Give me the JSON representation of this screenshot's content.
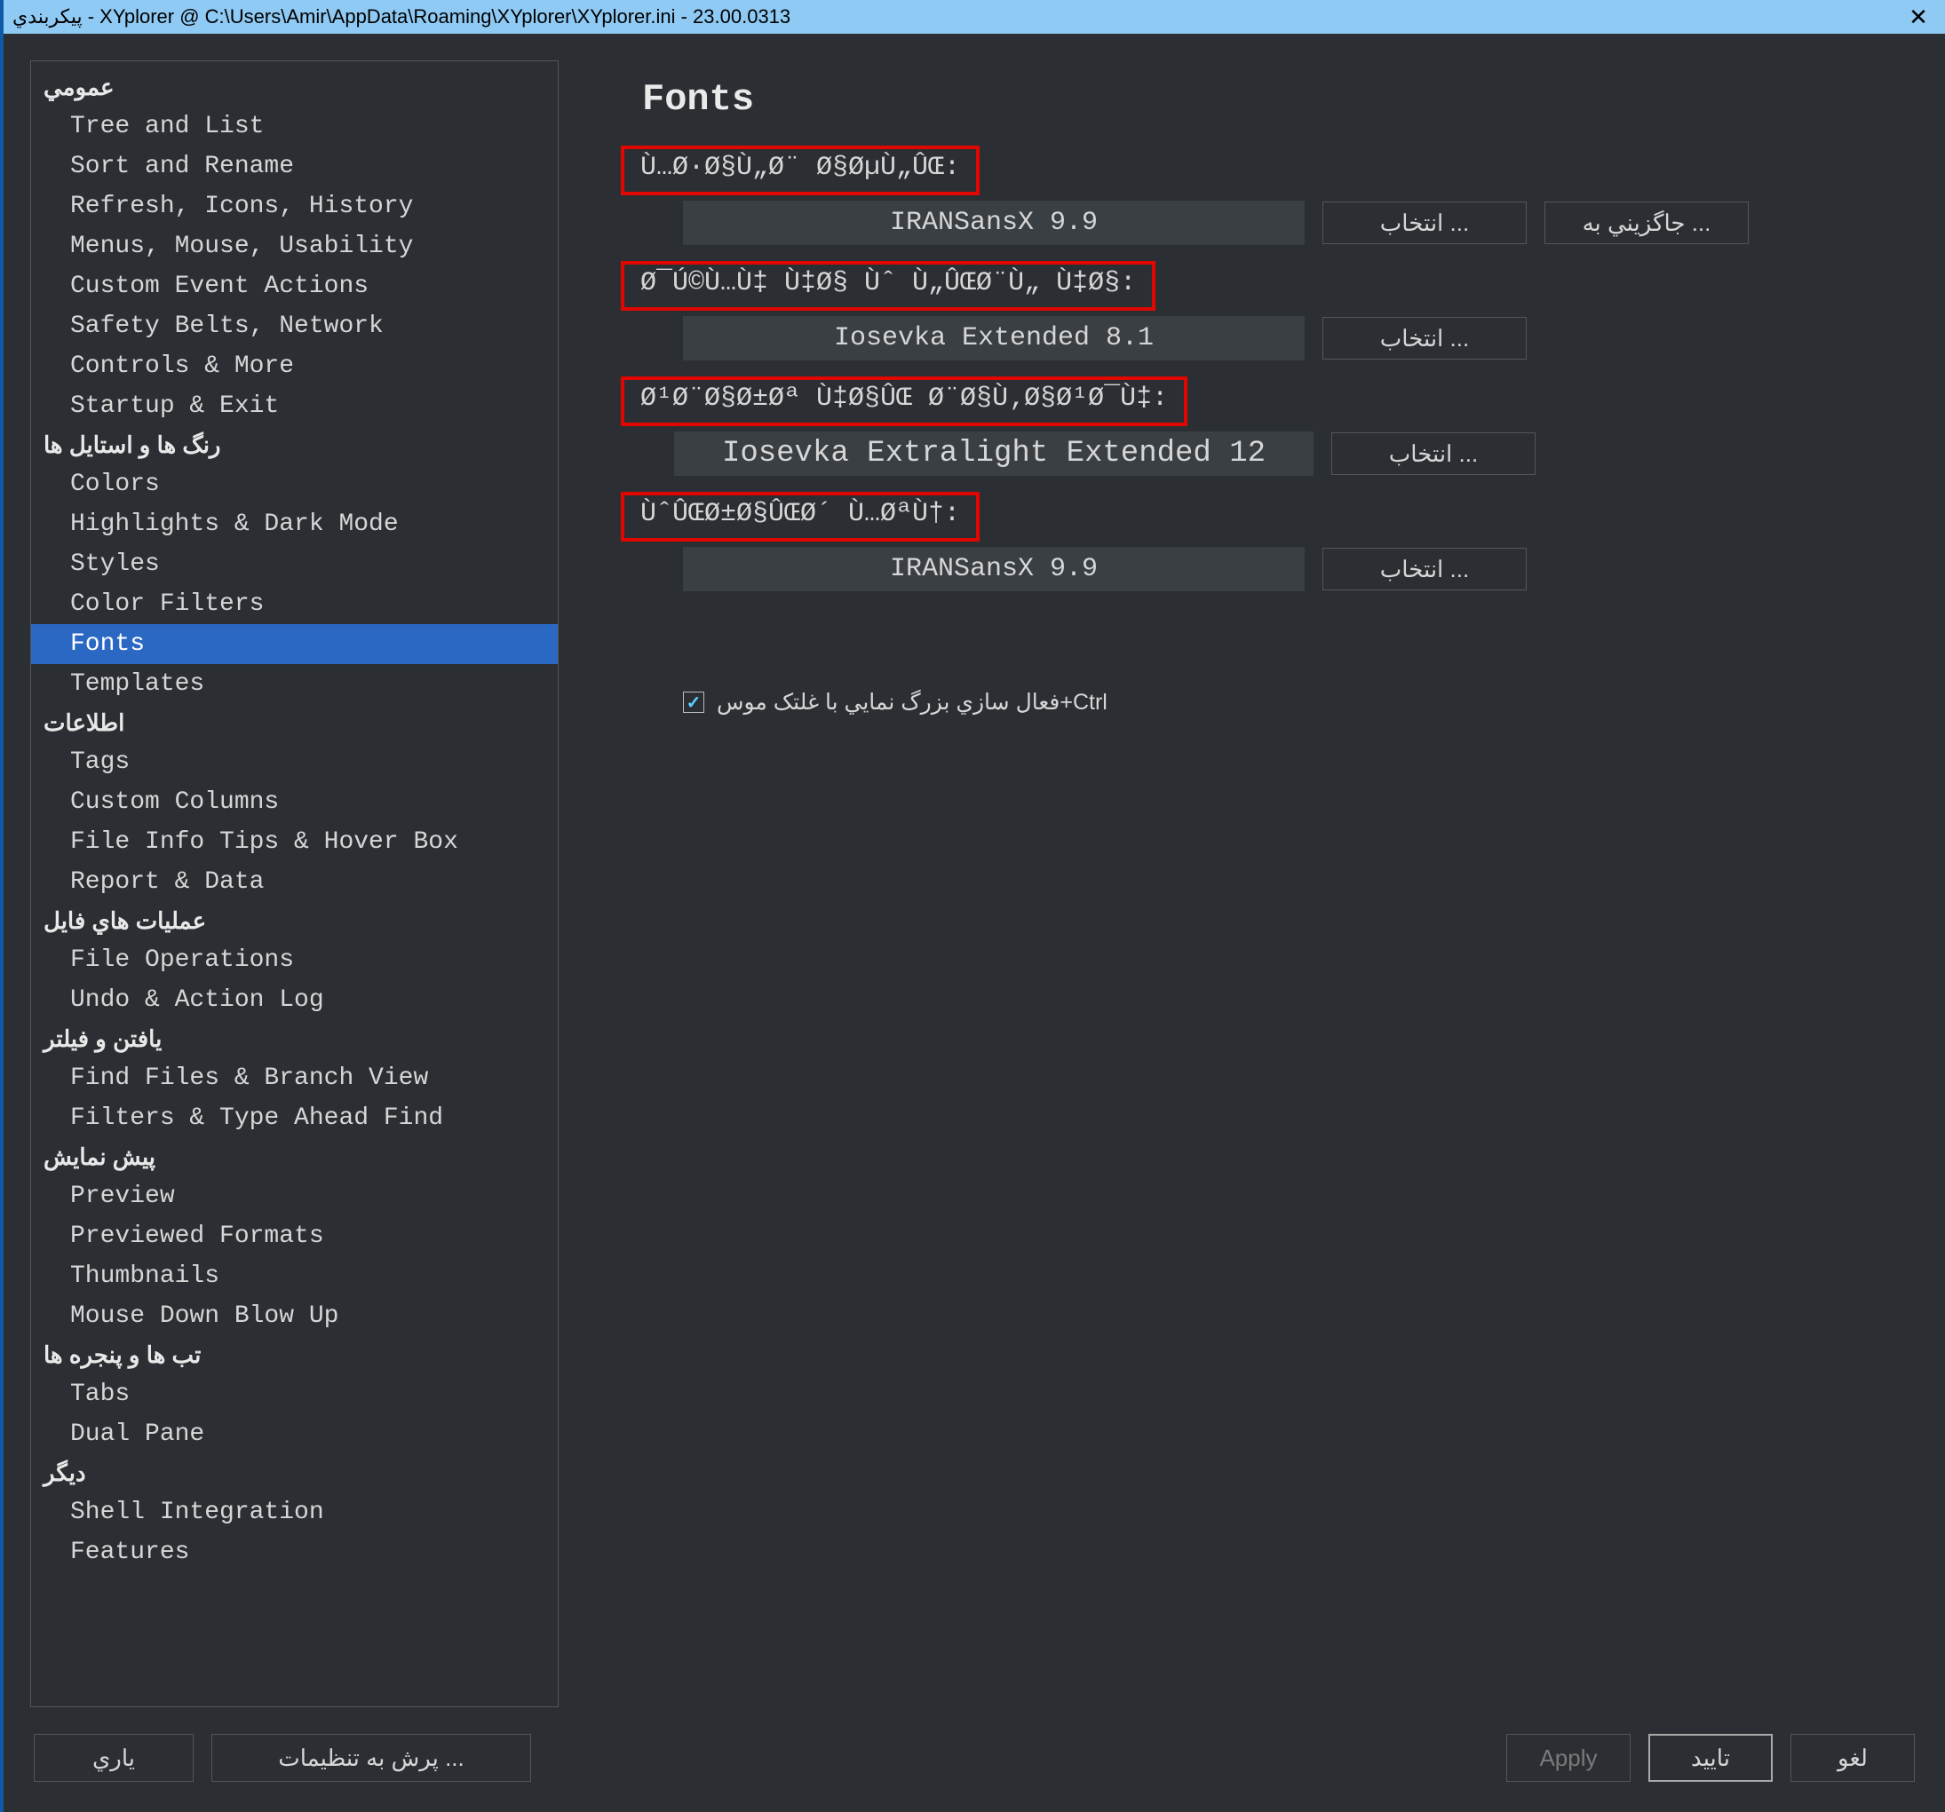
{
  "titlebar": {
    "text": "پيکربندي - XYplorer @ C:\\Users\\Amir\\AppData\\Roaming\\XYplorer\\XYplorer.ini - 23.00.0313"
  },
  "sidebar": {
    "sections": [
      {
        "header": "عمومي",
        "items": [
          "Tree and List",
          "Sort and Rename",
          "Refresh, Icons, History",
          "Menus, Mouse, Usability",
          "Custom Event Actions",
          "Safety Belts, Network",
          "Controls & More",
          "Startup & Exit"
        ]
      },
      {
        "header": "رنگ ها و استایل ها",
        "items": [
          "Colors",
          "Highlights & Dark Mode",
          "Styles",
          "Color Filters",
          "Fonts",
          "Templates"
        ],
        "selected": "Fonts"
      },
      {
        "header": "اطلاعات",
        "items": [
          "Tags",
          "Custom Columns",
          "File Info Tips & Hover Box",
          "Report & Data"
        ]
      },
      {
        "header": "عمليات هاي فايل",
        "items": [
          "File Operations",
          "Undo & Action Log"
        ]
      },
      {
        "header": "يافتن و فيلتر",
        "items": [
          "Find Files & Branch View",
          "Filters & Type Ahead Find"
        ]
      },
      {
        "header": "پيش نمايش",
        "items": [
          "Preview",
          "Previewed Formats",
          "Thumbnails",
          "Mouse Down Blow Up"
        ]
      },
      {
        "header": "تب ها و پنجره ها",
        "items": [
          "Tabs",
          "Dual Pane"
        ]
      },
      {
        "header": "ديگر",
        "items": [
          "Shell Integration",
          "Features"
        ]
      }
    ]
  },
  "main": {
    "heading": "Fonts",
    "rows": [
      {
        "label": "Ù…Ø·Ø§Ù„Ø¨ Ø§ØµÙ„ÛŒ:",
        "value": "IRANSansX 9.9",
        "buttons": [
          "انتخاب ...",
          "جاگزيني به ..."
        ]
      },
      {
        "label": "Ø¯Ú©Ù…Ù‡ Ù‡Ø§ Ùˆ Ù„ÛŒØ¨Ù„ Ù‡Ø§:",
        "value": "Iosevka Extended 8.1",
        "buttons": [
          "انتخاب ..."
        ]
      },
      {
        "label": "Ø¹Ø¨Ø§Ø±Øª Ù‡Ø§ÛŒ Ø¨Ø§Ù‚Ø§Ø¹Ø¯Ù‡:",
        "value": "Iosevka Extralight Extended 12",
        "buttons": [
          "انتخاب ..."
        ],
        "wide": true
      },
      {
        "label": "ÙˆÛŒØ±Ø§ÛŒØ´ Ù…ØªÙ†:",
        "value": "IRANSansX 9.9",
        "buttons": [
          "انتخاب ..."
        ]
      }
    ],
    "checkbox": {
      "checked": true,
      "label": "فعال سازي بزرگ نمايي با غلتک موس+Ctrl"
    }
  },
  "footer": {
    "help": "ياري",
    "jump": "پرش به تنظيمات ...",
    "apply": "Apply",
    "ok": "تاييد",
    "cancel": "لغو"
  }
}
